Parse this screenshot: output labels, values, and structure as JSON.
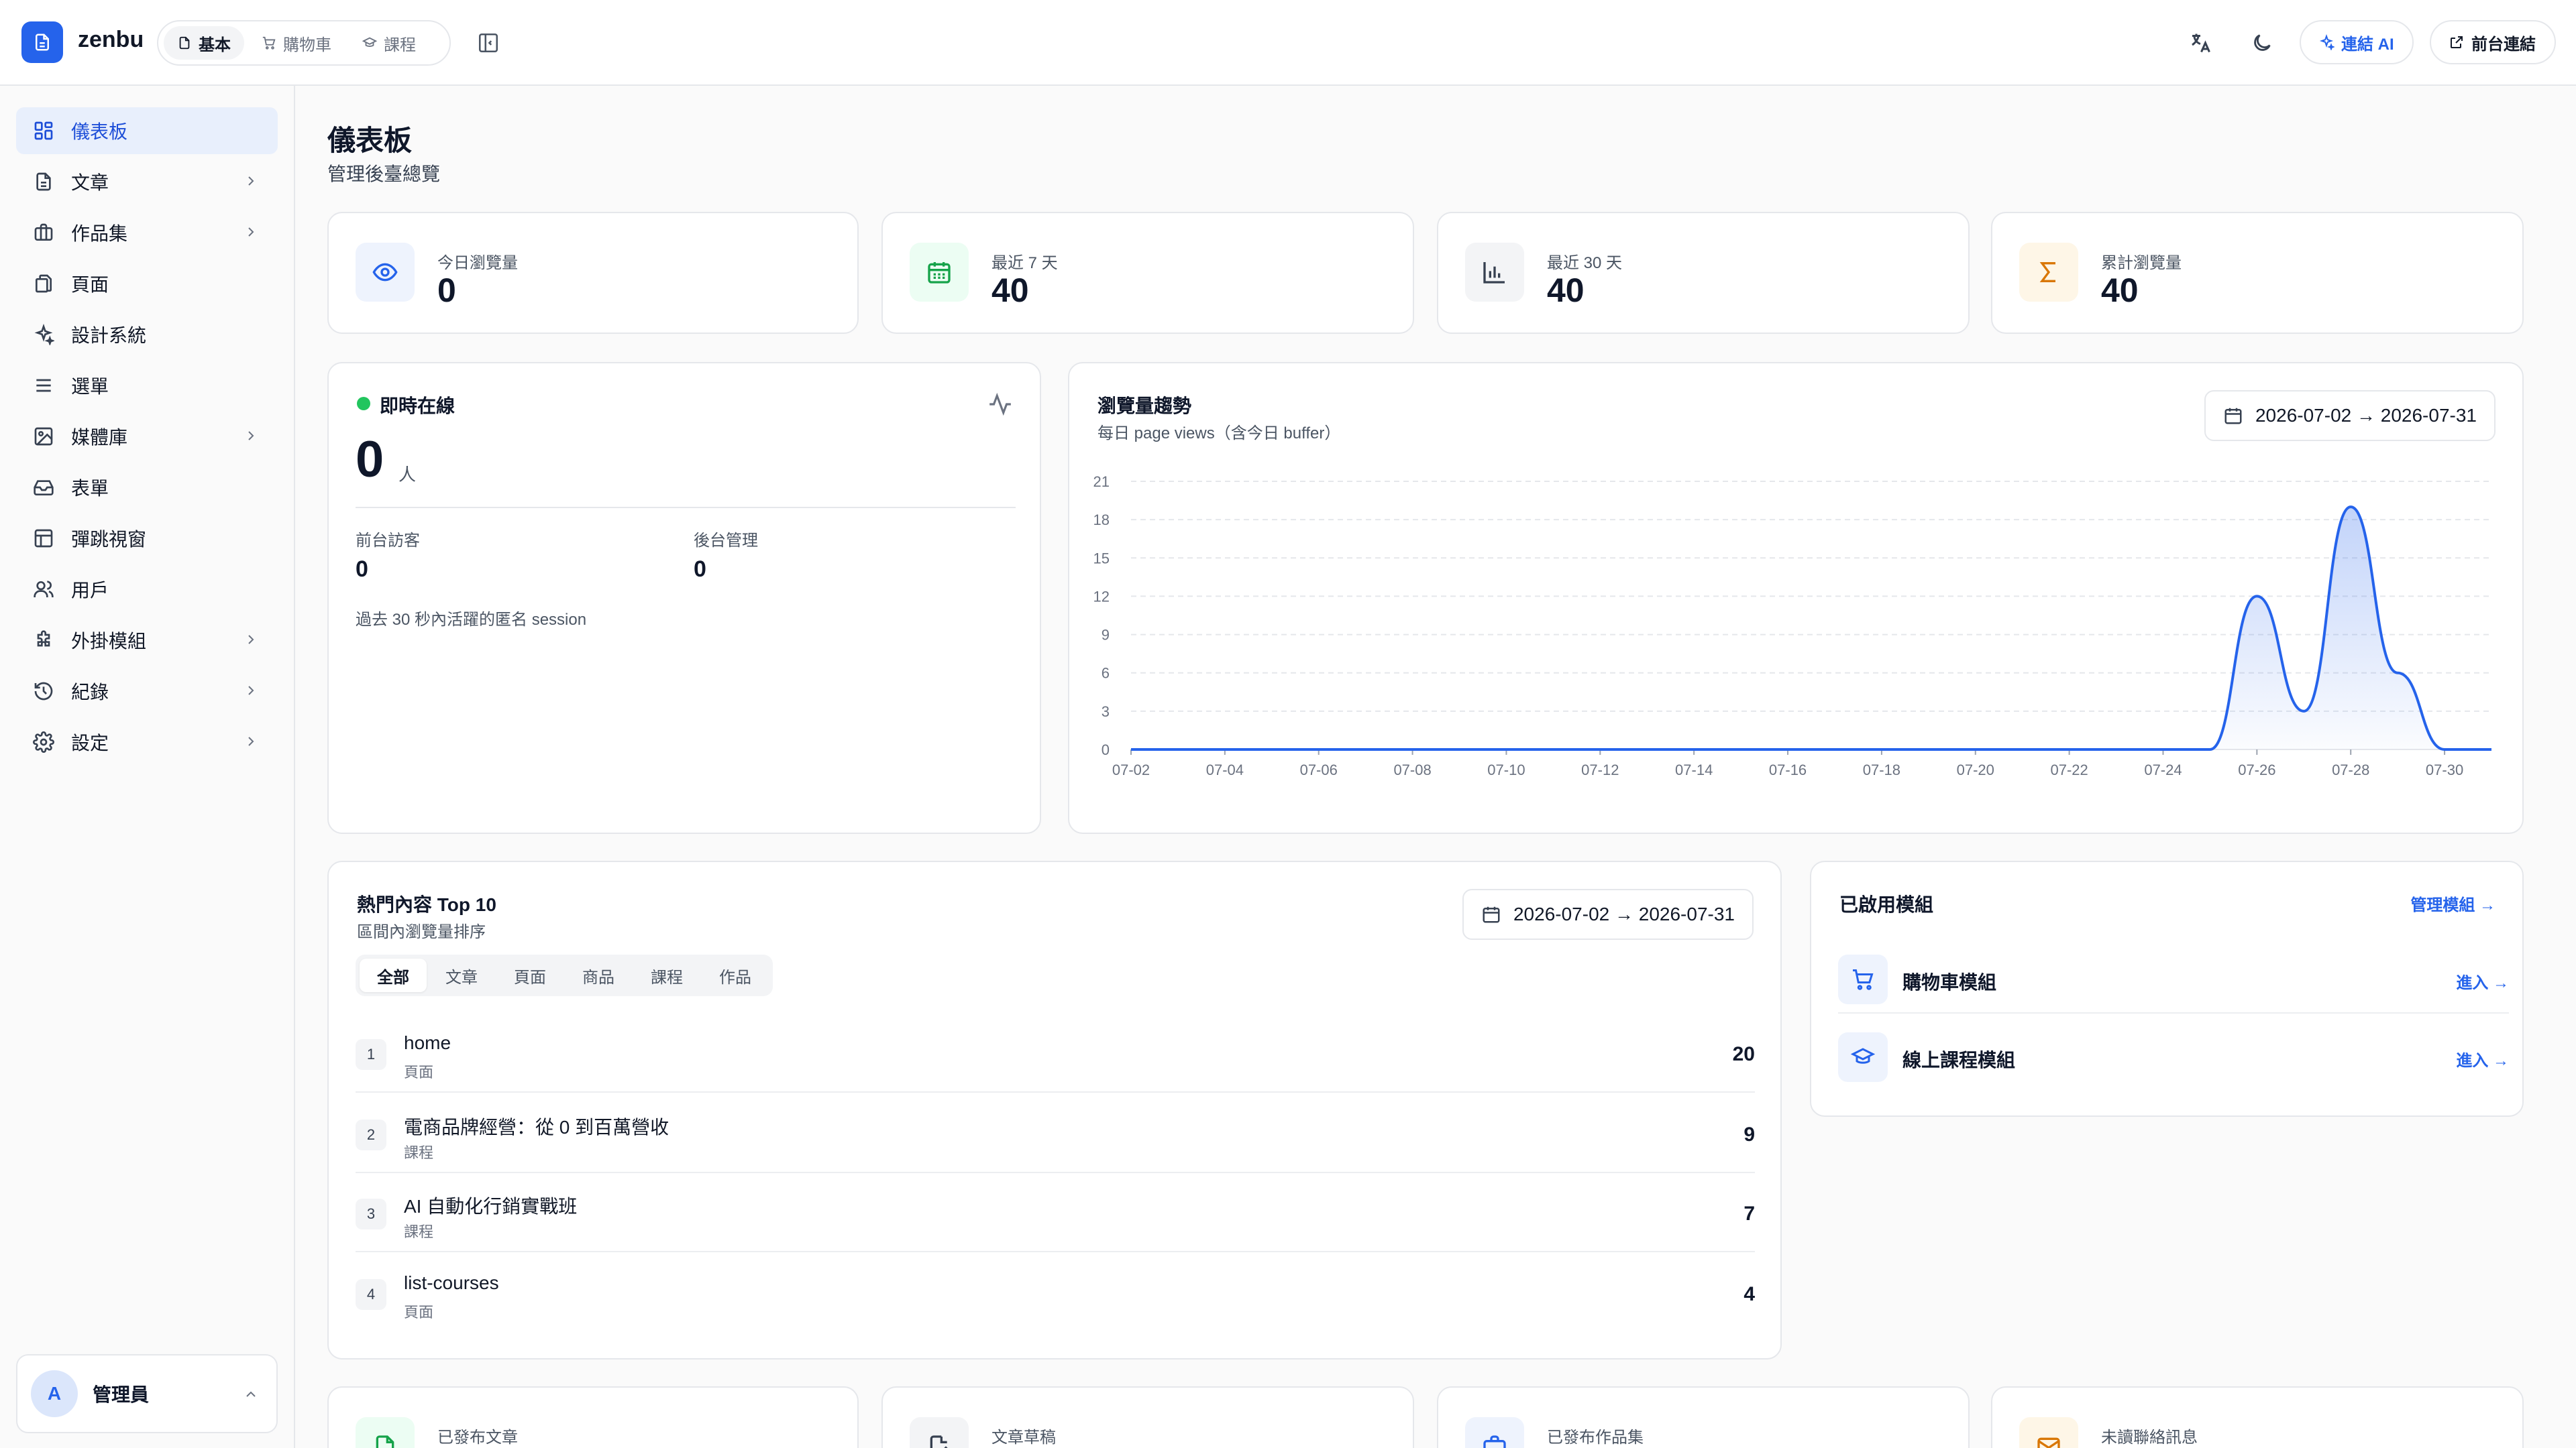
{
  "app": {
    "brand": "zenbu"
  },
  "header": {
    "mode_tabs": [
      {
        "label": "基本",
        "icon": "document-icon",
        "active": true
      },
      {
        "label": "購物車",
        "icon": "cart-icon",
        "active": false
      },
      {
        "label": "課程",
        "icon": "graduation-cap-icon",
        "active": false
      }
    ],
    "ai_button": "連結 AI",
    "frontend_button": "前台連結"
  },
  "sidebar": {
    "items": [
      {
        "label": "儀表板",
        "icon": "dashboard-icon",
        "active": true,
        "has_children": false
      },
      {
        "label": "文章",
        "icon": "document-icon",
        "active": false,
        "has_children": true
      },
      {
        "label": "作品集",
        "icon": "briefcase-icon",
        "active": false,
        "has_children": true
      },
      {
        "label": "頁面",
        "icon": "pages-icon",
        "active": false,
        "has_children": false
      },
      {
        "label": "設計系統",
        "icon": "sparkles-icon",
        "active": false,
        "has_children": false
      },
      {
        "label": "選單",
        "icon": "menu-icon",
        "active": false,
        "has_children": false
      },
      {
        "label": "媒體庫",
        "icon": "image-icon",
        "active": false,
        "has_children": true
      },
      {
        "label": "表單",
        "icon": "inbox-icon",
        "active": false,
        "has_children": false
      },
      {
        "label": "彈跳視窗",
        "icon": "layout-icon",
        "active": false,
        "has_children": false
      },
      {
        "label": "用戶",
        "icon": "users-icon",
        "active": false,
        "has_children": false
      },
      {
        "label": "外掛模組",
        "icon": "puzzle-icon",
        "active": false,
        "has_children": true
      },
      {
        "label": "紀錄",
        "icon": "history-icon",
        "active": false,
        "has_children": true
      },
      {
        "label": "設定",
        "icon": "gear-icon",
        "active": false,
        "has_children": true
      }
    ],
    "user": {
      "avatar": "A",
      "name": "管理員"
    }
  },
  "page": {
    "title": "儀表板",
    "subtitle": "管理後臺總覽"
  },
  "stats": [
    {
      "label": "今日瀏覽量",
      "value": "0",
      "icon": "eye-icon",
      "color": "#2563eb",
      "bg": "#eef3fd"
    },
    {
      "label": "最近 7 天",
      "value": "40",
      "icon": "calendar-icon",
      "color": "#16a34a",
      "bg": "#ecfdf3"
    },
    {
      "label": "最近 30 天",
      "value": "40",
      "icon": "bar-chart-icon",
      "color": "#374151",
      "bg": "#f3f4f6"
    },
    {
      "label": "累計瀏覽量",
      "value": "40",
      "icon": "sigma-icon",
      "color": "#d97706",
      "bg": "#fef6e7"
    }
  ],
  "realtime": {
    "title": "即時在線",
    "count": "0",
    "unit": "人",
    "frontend_label": "前台訪客",
    "frontend_value": "0",
    "admin_label": "後台管理",
    "admin_value": "0",
    "note": "過去 30 秒內活躍的匿名 session"
  },
  "trend": {
    "title": "瀏覽量趨勢",
    "subtitle": "每日 page views（含今日 buffer）",
    "date_range": "2026-07-02 → 2026-07-31"
  },
  "chart_data": {
    "type": "area",
    "title": "瀏覽量趨勢",
    "xlabel": "",
    "ylabel": "",
    "x": [
      "07-02",
      "07-03",
      "07-04",
      "07-05",
      "07-06",
      "07-07",
      "07-08",
      "07-09",
      "07-10",
      "07-11",
      "07-12",
      "07-13",
      "07-14",
      "07-15",
      "07-16",
      "07-17",
      "07-18",
      "07-19",
      "07-20",
      "07-21",
      "07-22",
      "07-23",
      "07-24",
      "07-25",
      "07-26",
      "07-27",
      "07-28",
      "07-29",
      "07-30",
      "07-31"
    ],
    "series": [
      {
        "values": [
          0,
          0,
          0,
          0,
          0,
          0,
          0,
          0,
          0,
          0,
          0,
          0,
          0,
          0,
          0,
          0,
          0,
          0,
          0,
          0,
          0,
          0,
          0,
          0,
          12,
          3,
          19,
          6,
          0,
          0
        ]
      }
    ],
    "x_tick_labels": [
      "07-02",
      "07-04",
      "07-06",
      "07-08",
      "07-10",
      "07-12",
      "07-14",
      "07-16",
      "07-18",
      "07-20",
      "07-22",
      "07-24",
      "07-26",
      "07-28",
      "07-30"
    ],
    "y_ticks": [
      0,
      3,
      6,
      9,
      12,
      15,
      18,
      21
    ],
    "ylim": [
      0,
      21
    ],
    "grid": true,
    "line_color": "#2563eb"
  },
  "top_content": {
    "title": "熱門內容 Top 10",
    "subtitle": "區間內瀏覽量排序",
    "date_range": "2026-07-02 → 2026-07-31",
    "filters": [
      "全部",
      "文章",
      "頁面",
      "商品",
      "課程",
      "作品"
    ],
    "active_filter": "全部",
    "rows": [
      {
        "rank": "1",
        "title": "home",
        "type": "頁面",
        "count": "20"
      },
      {
        "rank": "2",
        "title": "電商品牌經營：從 0 到百萬營收",
        "type": "課程",
        "count": "9"
      },
      {
        "rank": "3",
        "title": "AI 自動化行銷實戰班",
        "type": "課程",
        "count": "7"
      },
      {
        "rank": "4",
        "title": "list-courses",
        "type": "頁面",
        "count": "4"
      }
    ]
  },
  "modules": {
    "title": "已啟用模組",
    "manage_link": "管理模組 →",
    "items": [
      {
        "name": "購物車模組",
        "icon": "cart-icon",
        "link": "進入 →"
      },
      {
        "name": "線上課程模組",
        "icon": "graduation-cap-icon",
        "link": "進入 →"
      }
    ]
  },
  "bottom_stats": [
    {
      "label": "已發布文章",
      "icon": "document-icon",
      "color": "#16a34a",
      "bg": "#ecfdf3"
    },
    {
      "label": "文章草稿",
      "icon": "edit-document-icon",
      "color": "#374151",
      "bg": "#f3f4f6"
    },
    {
      "label": "已發布作品集",
      "icon": "briefcase-icon",
      "color": "#2563eb",
      "bg": "#eef3fd"
    },
    {
      "label": "未讀聯絡訊息",
      "icon": "mail-icon",
      "color": "#d97706",
      "bg": "#fef6e7"
    }
  ]
}
